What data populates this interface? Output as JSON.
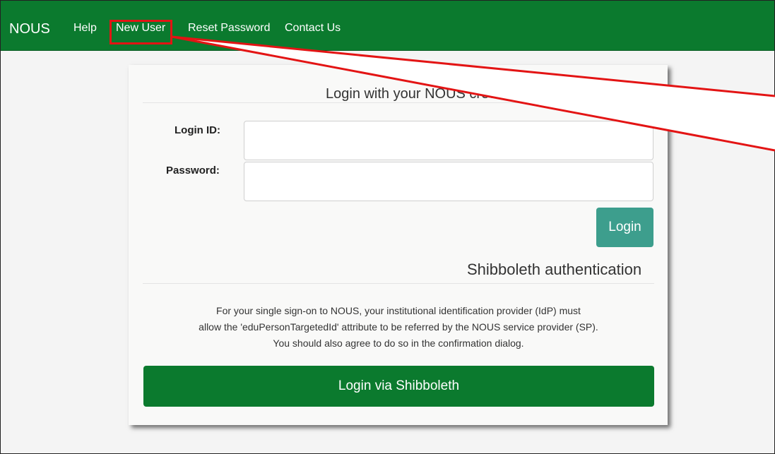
{
  "navbar": {
    "brand": "NOUS",
    "items": [
      {
        "label": "Help"
      },
      {
        "label": "New User"
      },
      {
        "label": "Reset Password"
      },
      {
        "label": "Contact Us"
      }
    ],
    "background_color": "#0b7a2e"
  },
  "login_panel": {
    "title": "Login with your NOUS credentials",
    "login_id_label": "Login ID:",
    "login_id_value": "",
    "password_label": "Password:",
    "password_value": "",
    "login_button": "Login"
  },
  "shibboleth": {
    "title": "Shibboleth authentication",
    "info_lines": [
      "For your single sign-on to NOUS, your institutional identification provider (IdP) must",
      "allow the 'eduPersonTargetedId' attribute to be referred by the NOUS service provider (SP).",
      "You should also agree to do so in the confirmation dialog."
    ],
    "button": "Login via Shibboleth"
  },
  "colors": {
    "accent": "#0b7a2e",
    "login_button": "#3d9e8d",
    "annotation": "#e31414"
  }
}
